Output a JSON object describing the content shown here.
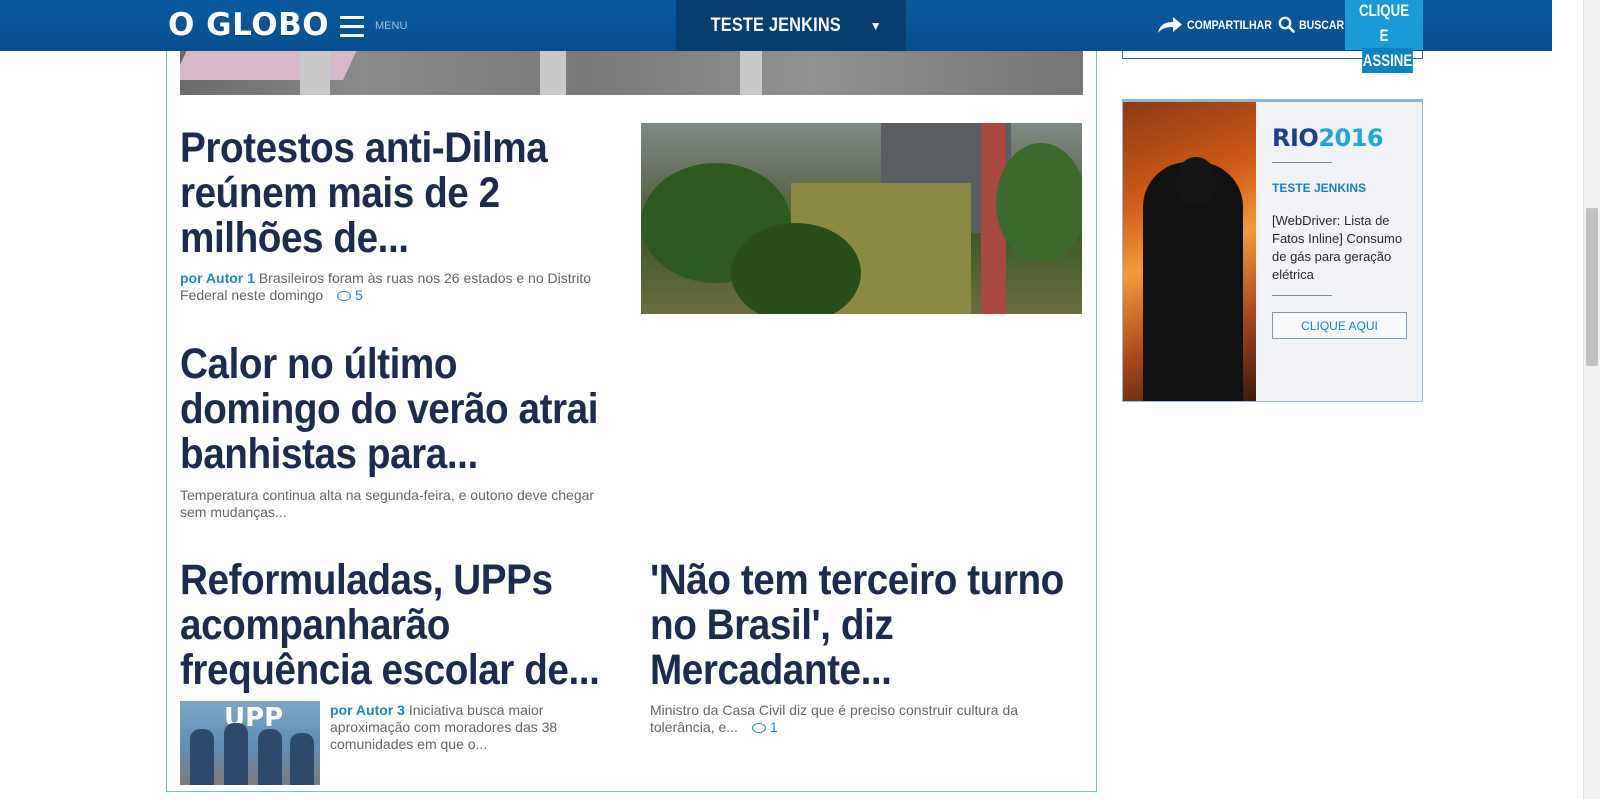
{
  "header": {
    "logo": "O GLOBO",
    "menu_label": "MENU",
    "section": "TESTE JENKINS",
    "section_arrow": "▼",
    "share_label": "COMPARTILHAR",
    "search_label": "BUSCAR",
    "subscribe_line1": "CLIQUE E",
    "subscribe_line2": "ASSINE"
  },
  "articles": [
    {
      "headline": [
        "Protestos anti-Dilma",
        "reúnem mais de 2",
        "milhões de..."
      ],
      "author": "por Autor 1",
      "summary": "Brasileiros foram às ruas nos 26 estados e no Distrito Federal neste domingo",
      "comments": "5"
    },
    {
      "headline": [
        "Calor no último",
        "domingo do verão atrai",
        "banhistas para..."
      ],
      "summary": "Temperatura continua alta na segunda-feira, e outono deve chegar sem mudanças..."
    },
    {
      "headline": [
        "Reformuladas, UPPs",
        "acompanharão",
        "frequência escolar de..."
      ],
      "author": "por Autor 3",
      "summary": "Iniciativa busca maior aproximação com moradores das 38 comunidades em que o..."
    },
    {
      "headline": [
        "'Não tem terceiro turno",
        "no Brasil', diz",
        "Mercadante..."
      ],
      "summary": "Ministro da Casa Civil diz que é preciso construir cultura da tolerância, e...",
      "comments": "1"
    }
  ],
  "upp_photo_sign": "UPP",
  "ad": {
    "logo_a": "RIO",
    "logo_b": "2016",
    "tag": "TESTE JENKINS",
    "text": "[WebDriver: Lista de Fatos Inline] Consumo de gás para geração elétrica",
    "button": "CLIQUE AQUI"
  },
  "colors": {
    "header_bg": "#0b5aa0",
    "headline": "#1d2b4f",
    "link": "#1c86c8",
    "subscribe": "#1a9ad8",
    "main_border": "#6fc6be"
  }
}
